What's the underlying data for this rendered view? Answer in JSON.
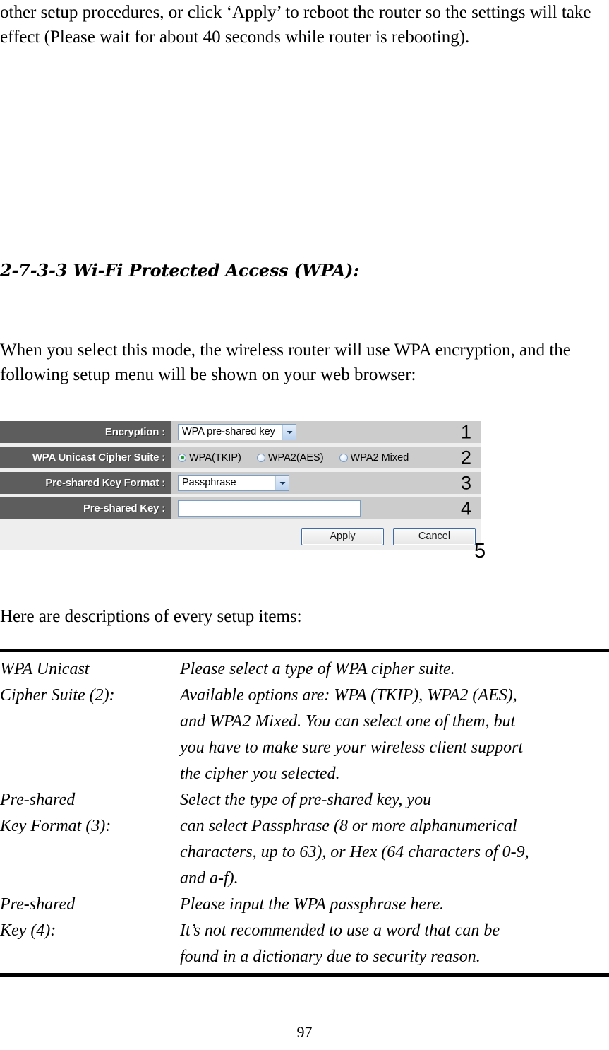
{
  "document": {
    "intro_paragraph": "other setup procedures, or click ‘Apply’ to reboot the router so the settings will take effect (Please wait for about 40 seconds while router is rebooting).",
    "section_heading": "2-7-3-3 Wi-Fi Protected Access (WPA):",
    "mode_paragraph": "When you select this mode, the wireless router will use WPA encryption, and the following setup menu will be shown on your web browser:",
    "descriptions_intro": "Here are descriptions of every setup items:",
    "page_number": "97"
  },
  "ui_panel": {
    "rows": [
      {
        "label": "Encryption :",
        "callout": "1",
        "control": "select",
        "value": "WPA pre-shared key"
      },
      {
        "label": "WPA Unicast Cipher Suite :",
        "callout": "2",
        "control": "radio-group",
        "options": [
          {
            "label": "WPA(TKIP)",
            "checked": true
          },
          {
            "label": "WPA2(AES)",
            "checked": false
          },
          {
            "label": "WPA2 Mixed",
            "checked": false
          }
        ]
      },
      {
        "label": "Pre-shared Key Format :",
        "callout": "3",
        "control": "select",
        "value": "Passphrase"
      },
      {
        "label": "Pre-shared Key :",
        "callout": "4",
        "control": "text",
        "value": ""
      }
    ],
    "buttons": {
      "apply_label": "Apply",
      "cancel_label": "Cancel",
      "callout": "5"
    },
    "colors": {
      "label_background": "#5d5d5d",
      "label_text": "#ffffff",
      "field_background": "#cccccc",
      "panel_background": "#eeeeee",
      "control_border": "#7b9ec4",
      "radio_selected_dot": "#1f9d28",
      "button_border": "#3f6ba8"
    }
  },
  "descriptions": [
    {
      "term_line1": "WPA Unicast",
      "term_line2": "Cipher Suite (2):",
      "definition_lines": [
        "Please select a type of WPA cipher suite.",
        "Available options are: WPA (TKIP), WPA2 (AES),",
        "and WPA2 Mixed. You can select one of them, but",
        "you have to make sure your wireless client support",
        "the cipher you selected."
      ]
    },
    {
      "term_line1": "Pre-shared",
      "term_line2": "Key Format (3):",
      "definition_lines": [
        "Select the type of pre-shared key, you",
        "can select Passphrase (8 or more alphanumerical",
        "characters, up to 63), or Hex (64 characters of 0-9,",
        "and a-f)."
      ]
    },
    {
      "term_line1": "Pre-shared",
      "term_line2": "Key (4):",
      "definition_lines": [
        "Please input the WPA passphrase here.",
        "It’s not recommended to use a word that can be",
        "found in a dictionary due to security reason."
      ]
    }
  ]
}
